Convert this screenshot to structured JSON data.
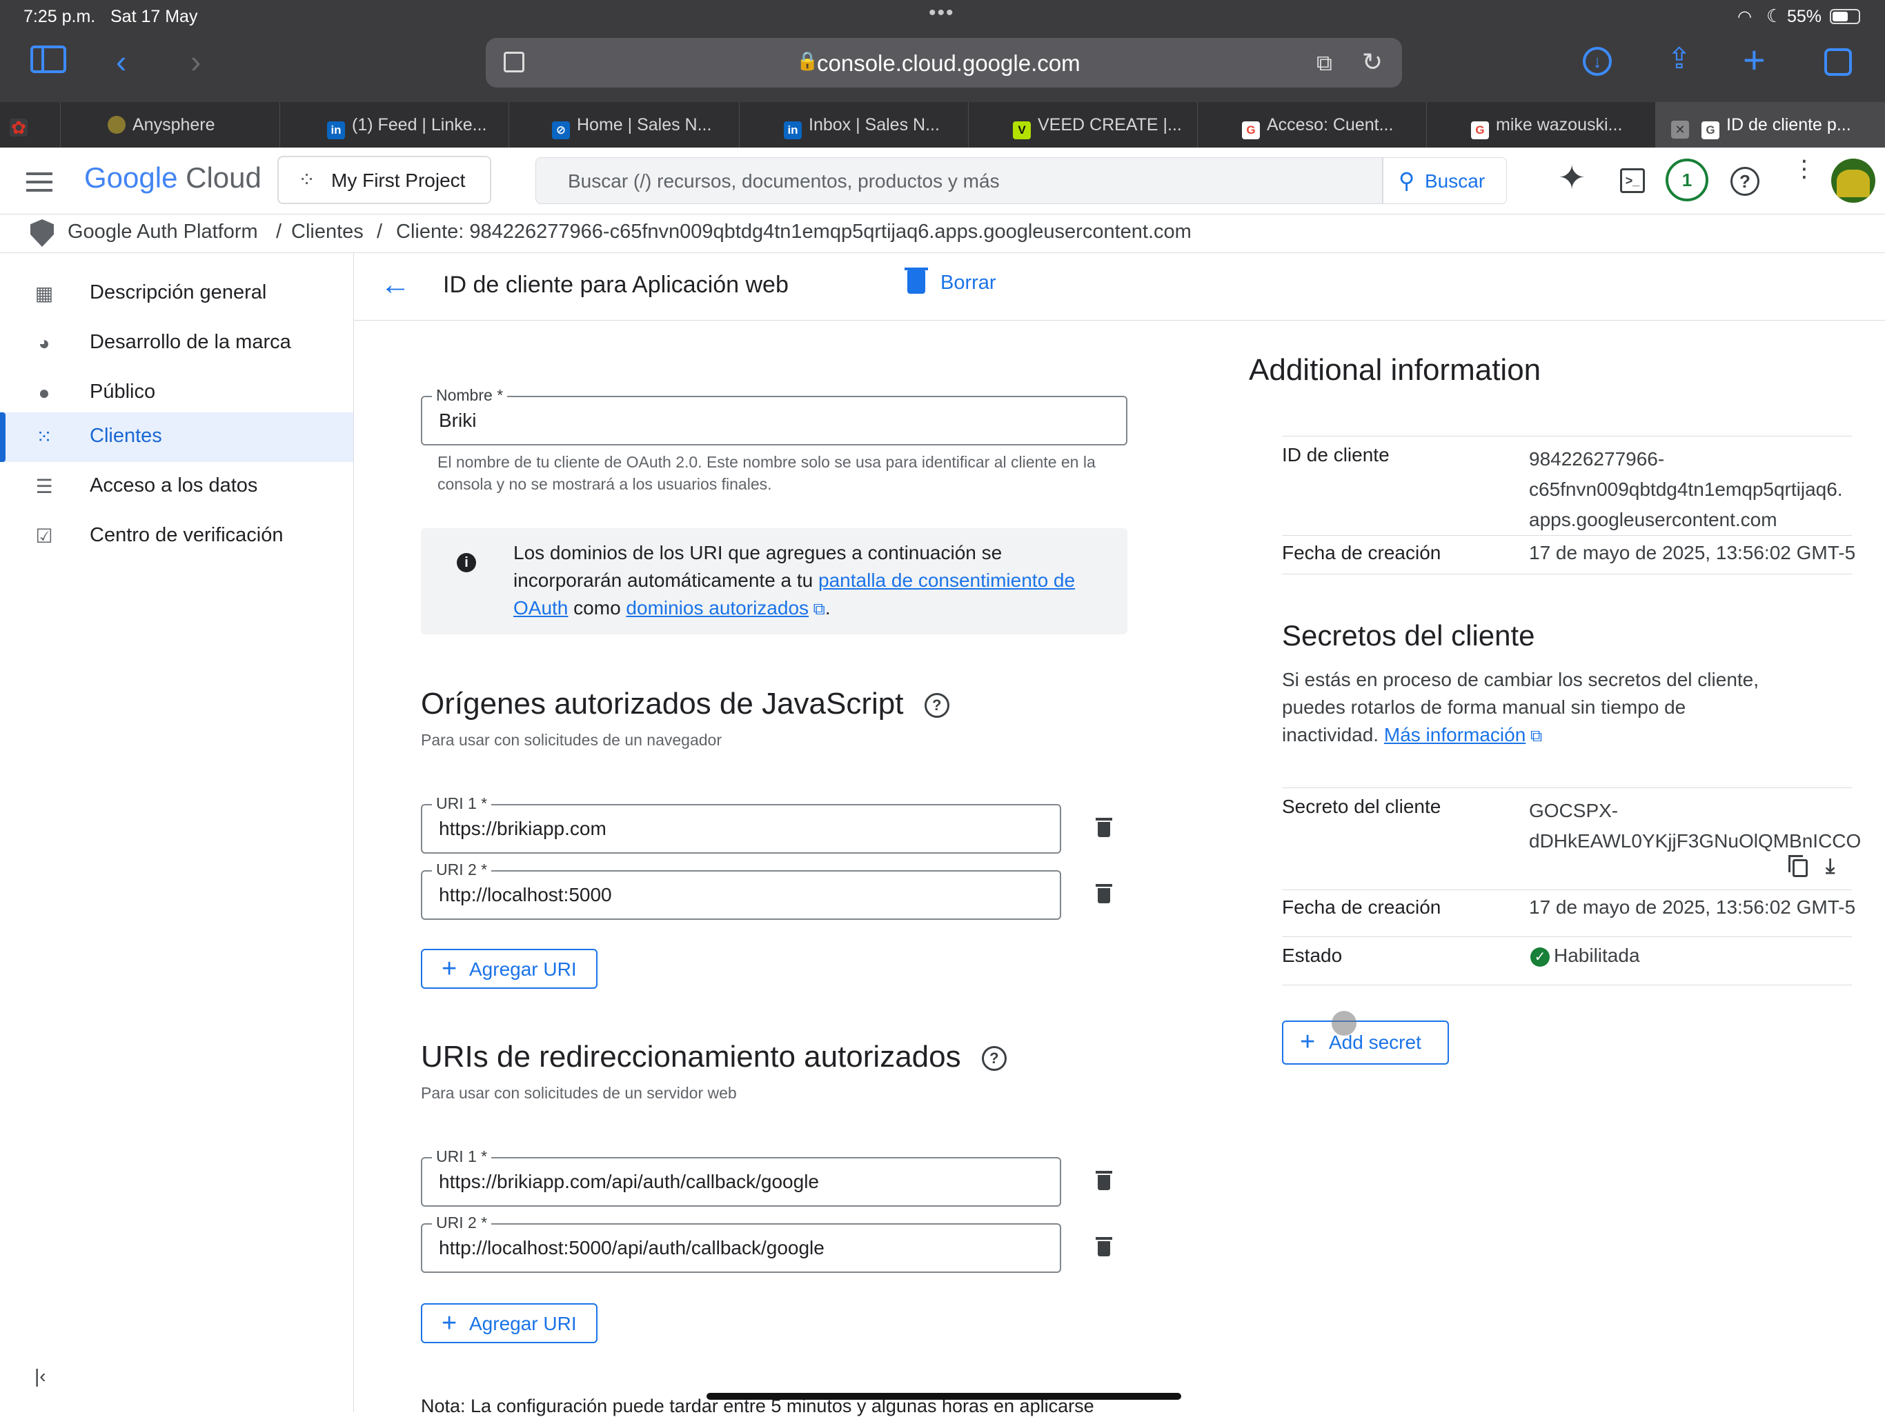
{
  "status_bar": {
    "time": "7:25 p.m.",
    "date": "Sat 17 May",
    "battery": "55%"
  },
  "browser": {
    "url": "console.cloud.google.com",
    "tabs": [
      {
        "label": "",
        "color": "#d93025"
      },
      {
        "label": "Anysphere",
        "color": "#5f6368"
      },
      {
        "label": "(1) Feed | Linke...",
        "color": "#0a66c2"
      },
      {
        "label": "Home | Sales N...",
        "color": "#0a66c2"
      },
      {
        "label": "Inbox | Sales N...",
        "color": "#0a66c2"
      },
      {
        "label": "VEED CREATE |...",
        "color": "#b3e100"
      },
      {
        "label": "Acceso: Cuent...",
        "color": "#ffffff"
      },
      {
        "label": "mike wazouski...",
        "color": "#ffffff"
      },
      {
        "label": "ID de cliente p...",
        "color": "#ffffff"
      }
    ]
  },
  "header": {
    "logo_google": "Google",
    "logo_cloud": "Cloud",
    "project": "My First Project",
    "search_placeholder": "Buscar (/) recursos, documentos, productos y más",
    "search_button": "Buscar",
    "notification_count": "1"
  },
  "breadcrumb": {
    "items": [
      "Google Auth Platform",
      "Clientes",
      "Cliente: 984226277966-c65fnvn009qbtdg4tn1emqp5qrtijaq6.apps.googleusercontent.com"
    ],
    "separator": "/"
  },
  "sidebar": {
    "items": [
      {
        "label": "Descripción general",
        "icon": "dashboard-icon"
      },
      {
        "label": "Desarrollo de la marca",
        "icon": "palette-icon"
      },
      {
        "label": "Público",
        "icon": "person-icon"
      },
      {
        "label": "Clientes",
        "icon": "apps-grid-icon",
        "active": true
      },
      {
        "label": "Acceso a los datos",
        "icon": "data-settings-icon"
      },
      {
        "label": "Centro de verificación",
        "icon": "verified-check-icon"
      }
    ]
  },
  "page": {
    "title": "ID de cliente para Aplicación web",
    "delete_label": "Borrar",
    "name_field": {
      "label": "Nombre *",
      "value": "Briki",
      "helper": "El nombre de tu cliente de OAuth 2.0. Este nombre solo se usa para identificar al cliente en la consola y no se mostrará a los usuarios finales."
    },
    "info_box": {
      "text_1": "Los dominios de los URI que agregues a continuación se incorporarán automáticamente a tu",
      "link_1": "pantalla de consentimiento de OAuth",
      "text_2": "como",
      "link_2": "dominios autorizados",
      "text_3": "."
    },
    "js_origins": {
      "title": "Orígenes autorizados de JavaScript",
      "subtitle": "Para usar con solicitudes de un navegador",
      "uris": [
        {
          "label": "URI 1 *",
          "value": "https://brikiapp.com"
        },
        {
          "label": "URI 2 *",
          "value": "http://localhost:5000"
        }
      ],
      "add_label": "Agregar URI"
    },
    "redirect_uris": {
      "title": "URIs de redireccionamiento autorizados",
      "subtitle": "Para usar con solicitudes de un servidor web",
      "uris": [
        {
          "label": "URI 1 *",
          "value": "https://brikiapp.com/api/auth/callback/google"
        },
        {
          "label": "URI 2 *",
          "value": "http://localhost:5000/api/auth/callback/google"
        }
      ],
      "add_label": "Agregar URI"
    },
    "note": "Nota: La configuración puede tardar entre 5 minutos y algunas horas en aplicarse"
  },
  "additional": {
    "title": "Additional information",
    "client_id_label": "ID de cliente",
    "client_id_lines": [
      "984226277966-",
      "c65fnvn009qbtdg4tn1emqp5qrtijaq6.",
      "apps.googleusercontent.com"
    ],
    "created_label": "Fecha de creación",
    "created_value": "17 de mayo de 2025, 13:56:02 GMT-5",
    "secrets_title": "Secretos del cliente",
    "secrets_desc": "Si estás en proceso de cambiar los secretos del cliente, puedes rotarlos de forma manual sin tiempo de inactividad.",
    "secrets_link": "Más información",
    "secret_label": "Secreto del cliente",
    "secret_lines": [
      "GOCSPX-",
      "dDHkEAWL0YKjjF3GNuOlQMBnICCO"
    ],
    "secret_created_label": "Fecha de creación",
    "secret_created_value": "17 de mayo de 2025, 13:56:02 GMT-5",
    "state_label": "Estado",
    "state_value": "Habilitada",
    "add_secret": "Add secret"
  }
}
